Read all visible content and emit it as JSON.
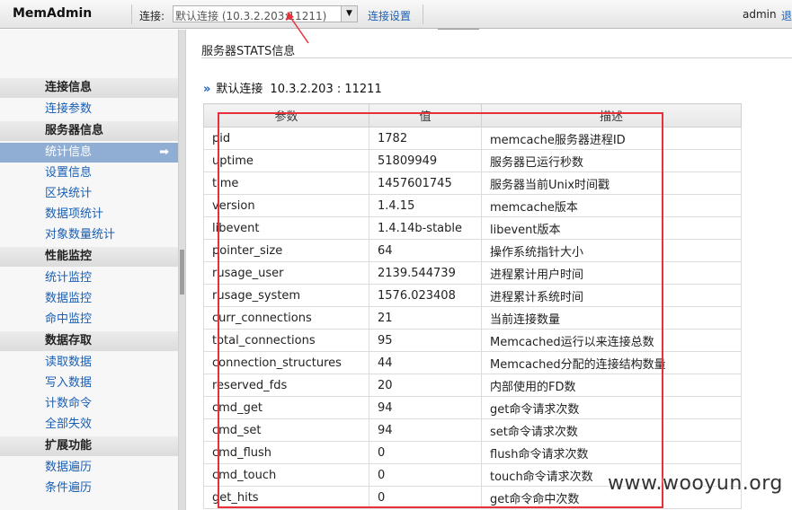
{
  "header": {
    "brand": "MemAdmin",
    "connection_label": "连接:",
    "connection_value": "默认连接 (10.3.2.203:11211)",
    "connection_settings": "连接设置",
    "user": "admin",
    "logout": "退"
  },
  "sidebar": {
    "sections": [
      {
        "title": "连接信息",
        "items": [
          {
            "label": "连接参数"
          }
        ]
      },
      {
        "title": "服务器信息",
        "items": [
          {
            "label": "统计信息",
            "active": true
          },
          {
            "label": "设置信息"
          },
          {
            "label": "区块统计"
          },
          {
            "label": "数据项统计"
          },
          {
            "label": "对象数量统计"
          }
        ]
      },
      {
        "title": "性能监控",
        "items": [
          {
            "label": "统计监控"
          },
          {
            "label": "数据监控"
          },
          {
            "label": "命中监控"
          }
        ]
      },
      {
        "title": "数据存取",
        "items": [
          {
            "label": "读取数据"
          },
          {
            "label": "写入数据"
          },
          {
            "label": "计数命令"
          },
          {
            "label": "全部失效"
          }
        ]
      },
      {
        "title": "扩展功能",
        "items": [
          {
            "label": "数据遍历"
          },
          {
            "label": "条件遍历"
          }
        ]
      }
    ]
  },
  "main": {
    "page_title": "服务器STATS信息",
    "connection_name": "默认连接",
    "connection_address": "10.3.2.203 : 11211",
    "table": {
      "columns": [
        "参数",
        "值",
        "描述"
      ],
      "rows": [
        [
          "pid",
          "1782",
          "memcache服务器进程ID"
        ],
        [
          "uptime",
          "51809949",
          "服务器已运行秒数"
        ],
        [
          "time",
          "1457601745",
          "服务器当前Unix时间戳"
        ],
        [
          "version",
          "1.4.15",
          "memcache版本"
        ],
        [
          "libevent",
          "1.4.14b-stable",
          "libevent版本"
        ],
        [
          "pointer_size",
          "64",
          "操作系统指针大小"
        ],
        [
          "rusage_user",
          "2139.544739",
          "进程累计用户时间"
        ],
        [
          "rusage_system",
          "1576.023408",
          "进程累计系统时间"
        ],
        [
          "curr_connections",
          "21",
          "当前连接数量"
        ],
        [
          "total_connections",
          "95",
          "Memcached运行以来连接总数"
        ],
        [
          "connection_structures",
          "44",
          "Memcached分配的连接结构数量"
        ],
        [
          "reserved_fds",
          "20",
          "内部使用的FD数"
        ],
        [
          "cmd_get",
          "94",
          "get命令请求次数"
        ],
        [
          "cmd_set",
          "94",
          "set命令请求次数"
        ],
        [
          "cmd_flush",
          "0",
          "flush命令请求次数"
        ],
        [
          "cmd_touch",
          "0",
          "touch命令请求次数"
        ],
        [
          "get_hits",
          "0",
          "get命令命中次数"
        ]
      ]
    }
  },
  "annotation": {
    "color": "#e8303a"
  },
  "watermark": "www.wooyun.org",
  "colors": {
    "link": "#1a5fb4",
    "active_nav": "#90aed3"
  }
}
